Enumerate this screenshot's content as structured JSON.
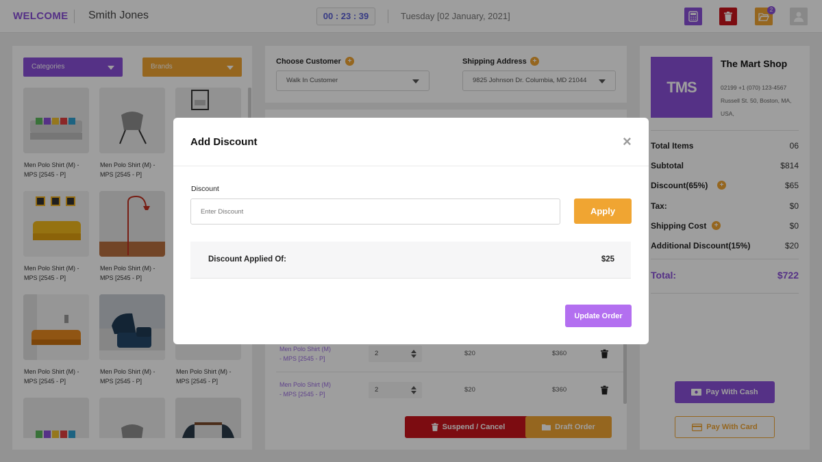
{
  "header": {
    "welcome": "WELCOME",
    "user": "Smith Jones",
    "timer": "00 : 23 : 39",
    "date": "Tuesday [02 January, 2021]",
    "folder_badge": "2"
  },
  "products": {
    "categories_label": "Categories",
    "brands_label": "Brands",
    "items": [
      {
        "name": "Men Polo Shirt (M) - MPS [2545 - P]",
        "icon": "sofa-multicolor"
      },
      {
        "name": "Men Polo Shirt (M) - MPS [2545 - P]",
        "icon": "chair-grey"
      },
      {
        "name": "Men Polo Shirt (M) - MPS [2545 - P]",
        "icon": "frame"
      },
      {
        "name": "Men Polo Shirt (M) - MPS [2545 - P]",
        "icon": "sofa-yellow"
      },
      {
        "name": "Men Polo Shirt (M) - MPS [2545 - P]",
        "icon": "floor-lamp"
      },
      {
        "name": "Men Polo Shirt (M) - MPS [2545 - P]",
        "icon": "sofa-orange"
      },
      {
        "name": "Men Polo Shirt (M) - MPS [2545 - P]",
        "icon": "armchair-blue"
      },
      {
        "name": "Men Polo Shirt (M) - MPS [2545 - P]",
        "icon": "room"
      }
    ]
  },
  "order": {
    "customer_label": "Choose Customer",
    "customer_value": "Walk In Customer",
    "shipping_label": "Shipping Address",
    "shipping_value": "9825 Johnson Dr. Columbia, MD 21044",
    "rows": [
      {
        "name": "Men Polo Shirt (M) - MPS [2545 - P]",
        "qty": "2",
        "price": "$20",
        "total": "$360"
      },
      {
        "name": "Men Polo Shirt (M) - MPS [2545 - P]",
        "qty": "2",
        "price": "$20",
        "total": "$360"
      }
    ],
    "suspend_label": "Suspend / Cancel",
    "draft_label": "Draft Order"
  },
  "shop": {
    "logo": "TMS",
    "name": "The Mart Shop",
    "phone": "02199 +1 (070) 123-4567",
    "address1": "Russell St. 50, Boston, MA,",
    "address2": "USA,"
  },
  "summary": {
    "total_items_label": "Total Items",
    "total_items": "06",
    "subtotal_label": "Subtotal",
    "subtotal": "$814",
    "discount_label": "Discount(65%)",
    "discount": "$65",
    "tax_label": "Tax:",
    "tax": "$0",
    "shipping_label": "Shipping Cost",
    "shipping": "$0",
    "add_discount_label": "Additional Discount(15%)",
    "add_discount": "$20",
    "total_label": "Total:",
    "total": "$722",
    "pay_cash": "Pay With Cash",
    "pay_card": "Pay With Card"
  },
  "modal": {
    "title": "Add Discount",
    "close": "×",
    "discount_label": "Discount",
    "discount_placeholder": "Enter Discount",
    "apply": "Apply",
    "applied_label": "Discount Applied Of:",
    "applied_value": "$25",
    "update": "Update Order"
  },
  "colors": {
    "purple": "#8a4fd8",
    "orange": "#f0a532",
    "red": "#c8141c",
    "light_purple": "#b36ff0"
  }
}
